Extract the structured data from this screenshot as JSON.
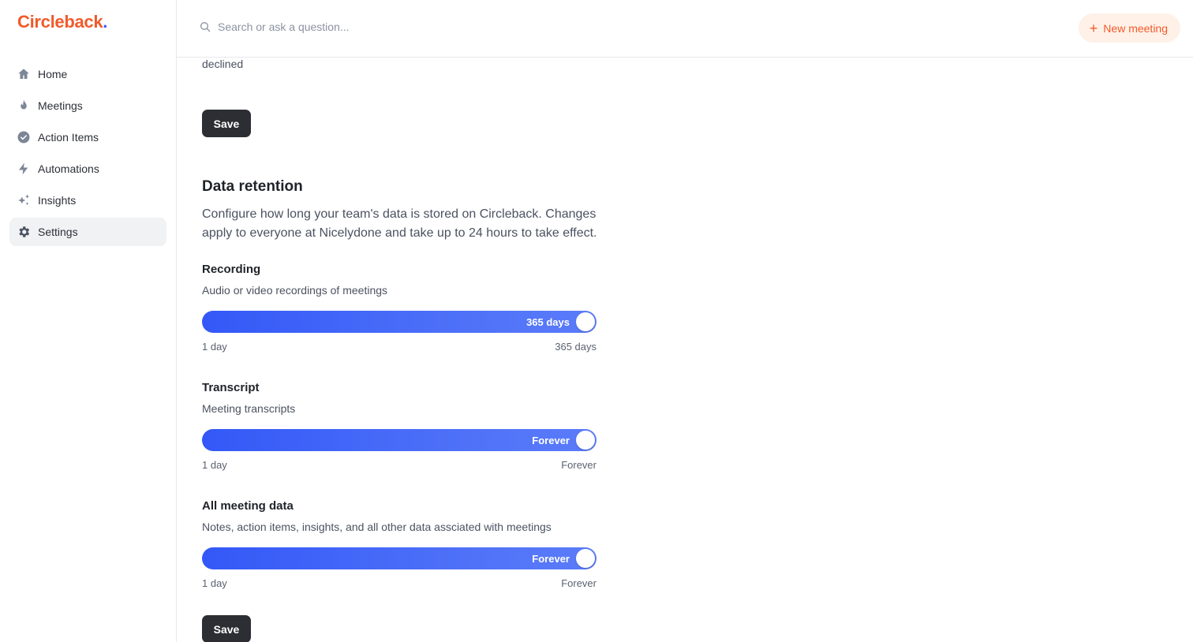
{
  "brand": {
    "name": "Circleback",
    "dot": "."
  },
  "sidebar": {
    "items": [
      {
        "label": "Home",
        "icon": "home-icon"
      },
      {
        "label": "Meetings",
        "icon": "flame-icon"
      },
      {
        "label": "Action Items",
        "icon": "check-circle-icon"
      },
      {
        "label": "Automations",
        "icon": "bolt-icon"
      },
      {
        "label": "Insights",
        "icon": "sparkles-icon"
      },
      {
        "label": "Settings",
        "icon": "gear-icon",
        "active": true
      }
    ]
  },
  "topbar": {
    "search_placeholder": "Search or ask a question...",
    "new_meeting_label": "New meeting",
    "new_meeting_icon": "+"
  },
  "main": {
    "declined_text": "declined",
    "save_label": "Save",
    "data_retention": {
      "title": "Data retention",
      "description": "Configure how long your team's data is stored on Circleback. Changes apply to everyone at Nicelydone and take up to 24 hours to take effect.",
      "items": [
        {
          "title": "Recording",
          "subtitle": "Audio or video recordings of meetings",
          "value": "365 days",
          "min": "1 day",
          "max": "365 days"
        },
        {
          "title": "Transcript",
          "subtitle": "Meeting transcripts",
          "value": "Forever",
          "min": "1 day",
          "max": "Forever"
        },
        {
          "title": "All meeting data",
          "subtitle": "Notes, action items, insights, and all other data assciated with meetings",
          "value": "Forever",
          "min": "1 day",
          "max": "Forever"
        }
      ],
      "save_label": "Save"
    }
  },
  "colors": {
    "brand": "#f15a2b",
    "accent": "#3b5bfd",
    "slider": "#4a6df8",
    "button": "#2c2e33"
  }
}
